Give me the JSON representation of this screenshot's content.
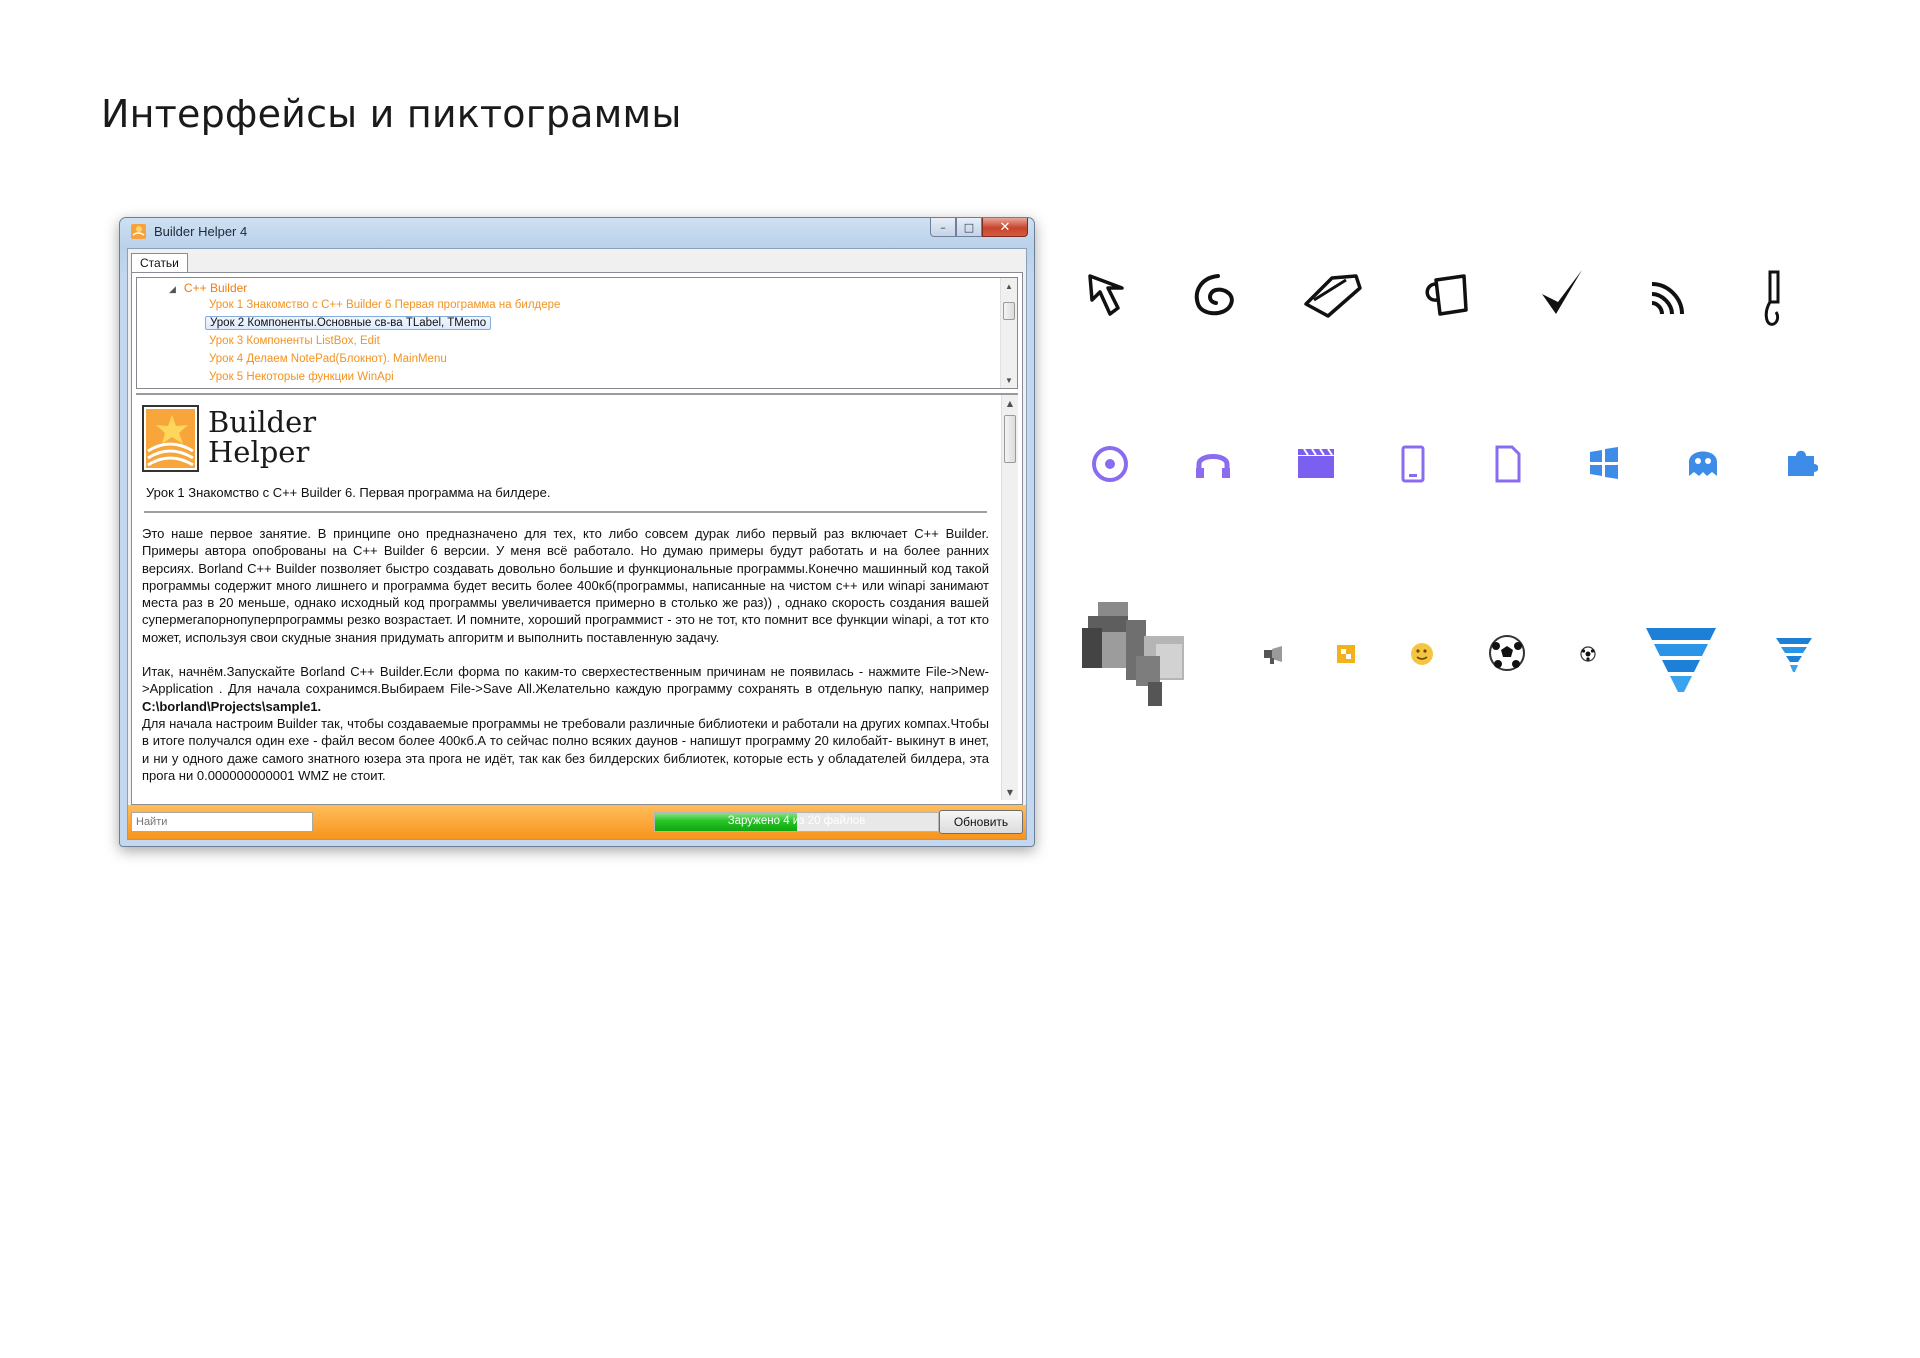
{
  "page": {
    "title": "Интерфейсы и пиктограммы"
  },
  "window": {
    "title": "Builder Helper 4",
    "controls": {
      "minimize": "–",
      "maximize": "□",
      "close": "✕"
    },
    "tab": "Статьи",
    "tree": {
      "root": "C++ Builder",
      "items": [
        "Урок 1 Знакомство с C++ Builder 6 Первая программа на билдере",
        "Урок 2  Компоненты.Основные св-ва  TLabel, TMemo",
        "Урок 3  Компоненты  ListBox, Edit",
        "Урок 4  Делаем NotePad(Блокнот). MainMenu",
        "Урок 5  Некоторые функции WinApi"
      ],
      "selected_index": 1
    },
    "article": {
      "logo_line1": "Builder",
      "logo_line2": "Helper",
      "lesson_title": "Урок 1 Знакомство с C++ Builder 6. Первая программа на билдере.",
      "paragraph1": "Это наше первое занятие. В принципе оно предназначено для тех, кто либо совсем дурак либо первый раз включает C++ Builder. Примеры автора опоброваны на C++ Builder 6 версии. У меня всё работало. Но думаю примеры будут работать и на более ранних версиях. Borland C++ Builder позволяет быстро создавать довольно большие и функциональные программы.Конечно машинный код такой программы содержит много лишнего и программа будет весить более 400кб(программы, написанные на чистом c++ или winapi занимают места раз в 20 меньше, однако исходный код программы увеличивается примерно в столько же раз)) , однако скорость создания вашей супермегапорнопуперпрограммы резко возрастает. И помните, хороший программист - это не тот, кто помнит все функции winapi, а тот кто может, используя свои скудные знания придумать апгоритм и выполнить поставленную задачу.",
      "paragraph2_start": "Итак, начнём.Запускайте Borland C++ Builder.Если форма по каким-то сверхестественным причинам не появилась - нажмите File->New->Application . Для начала сохранимся.Выбираем File->Save All.Желательно каждую программу сохранять в отдельную папку, например ",
      "paragraph2_path": "C:\\borland\\Projects\\sample1.",
      "paragraph3": "Для начала настроим Builder так, чтобы создаваемые программы не требовали различные библиотеки и работали на других компах.Чтобы в итоге получался один exe - файл весом более 400кб.А то сейчас полно всяких даунов - напишут программу 20 килобайт- выкинут в инет, и ни у одного даже самого знатного юзера эта прога не идёт, так как без билдерских библиотек, которые есть у обладателей билдера, эта прога ни 0.000000000001 WMZ не стоит."
    },
    "footer": {
      "search_placeholder": "Найти",
      "progress_text": "Заружено 4 из 20 файлов",
      "progress_fraction": 0.5,
      "refresh_label": "Обновить"
    }
  },
  "icons": {
    "row1": [
      "cursor-arrow-icon",
      "spiral-icon",
      "tag-icon",
      "mug-icon",
      "checkmark-icon",
      "rss-icon",
      "pen-icon"
    ],
    "row2": [
      "disc-icon",
      "headphones-icon",
      "clapperboard-icon",
      "phone-icon",
      "document-icon",
      "windows-icon",
      "ghost-icon",
      "puzzle-icon"
    ],
    "row3": [
      "megaphone-large-icon",
      "megaphone-small-icon",
      "yellow-square-icon",
      "smiley-icon",
      "soccer-ball-large-icon",
      "soccer-ball-small-icon",
      "tornado-large-icon",
      "tornado-small-icon"
    ],
    "colors": {
      "line_icon": "#111111",
      "purple": "#8a6cf0",
      "blue": "#3d8de8",
      "orange": "#f7941d"
    }
  }
}
